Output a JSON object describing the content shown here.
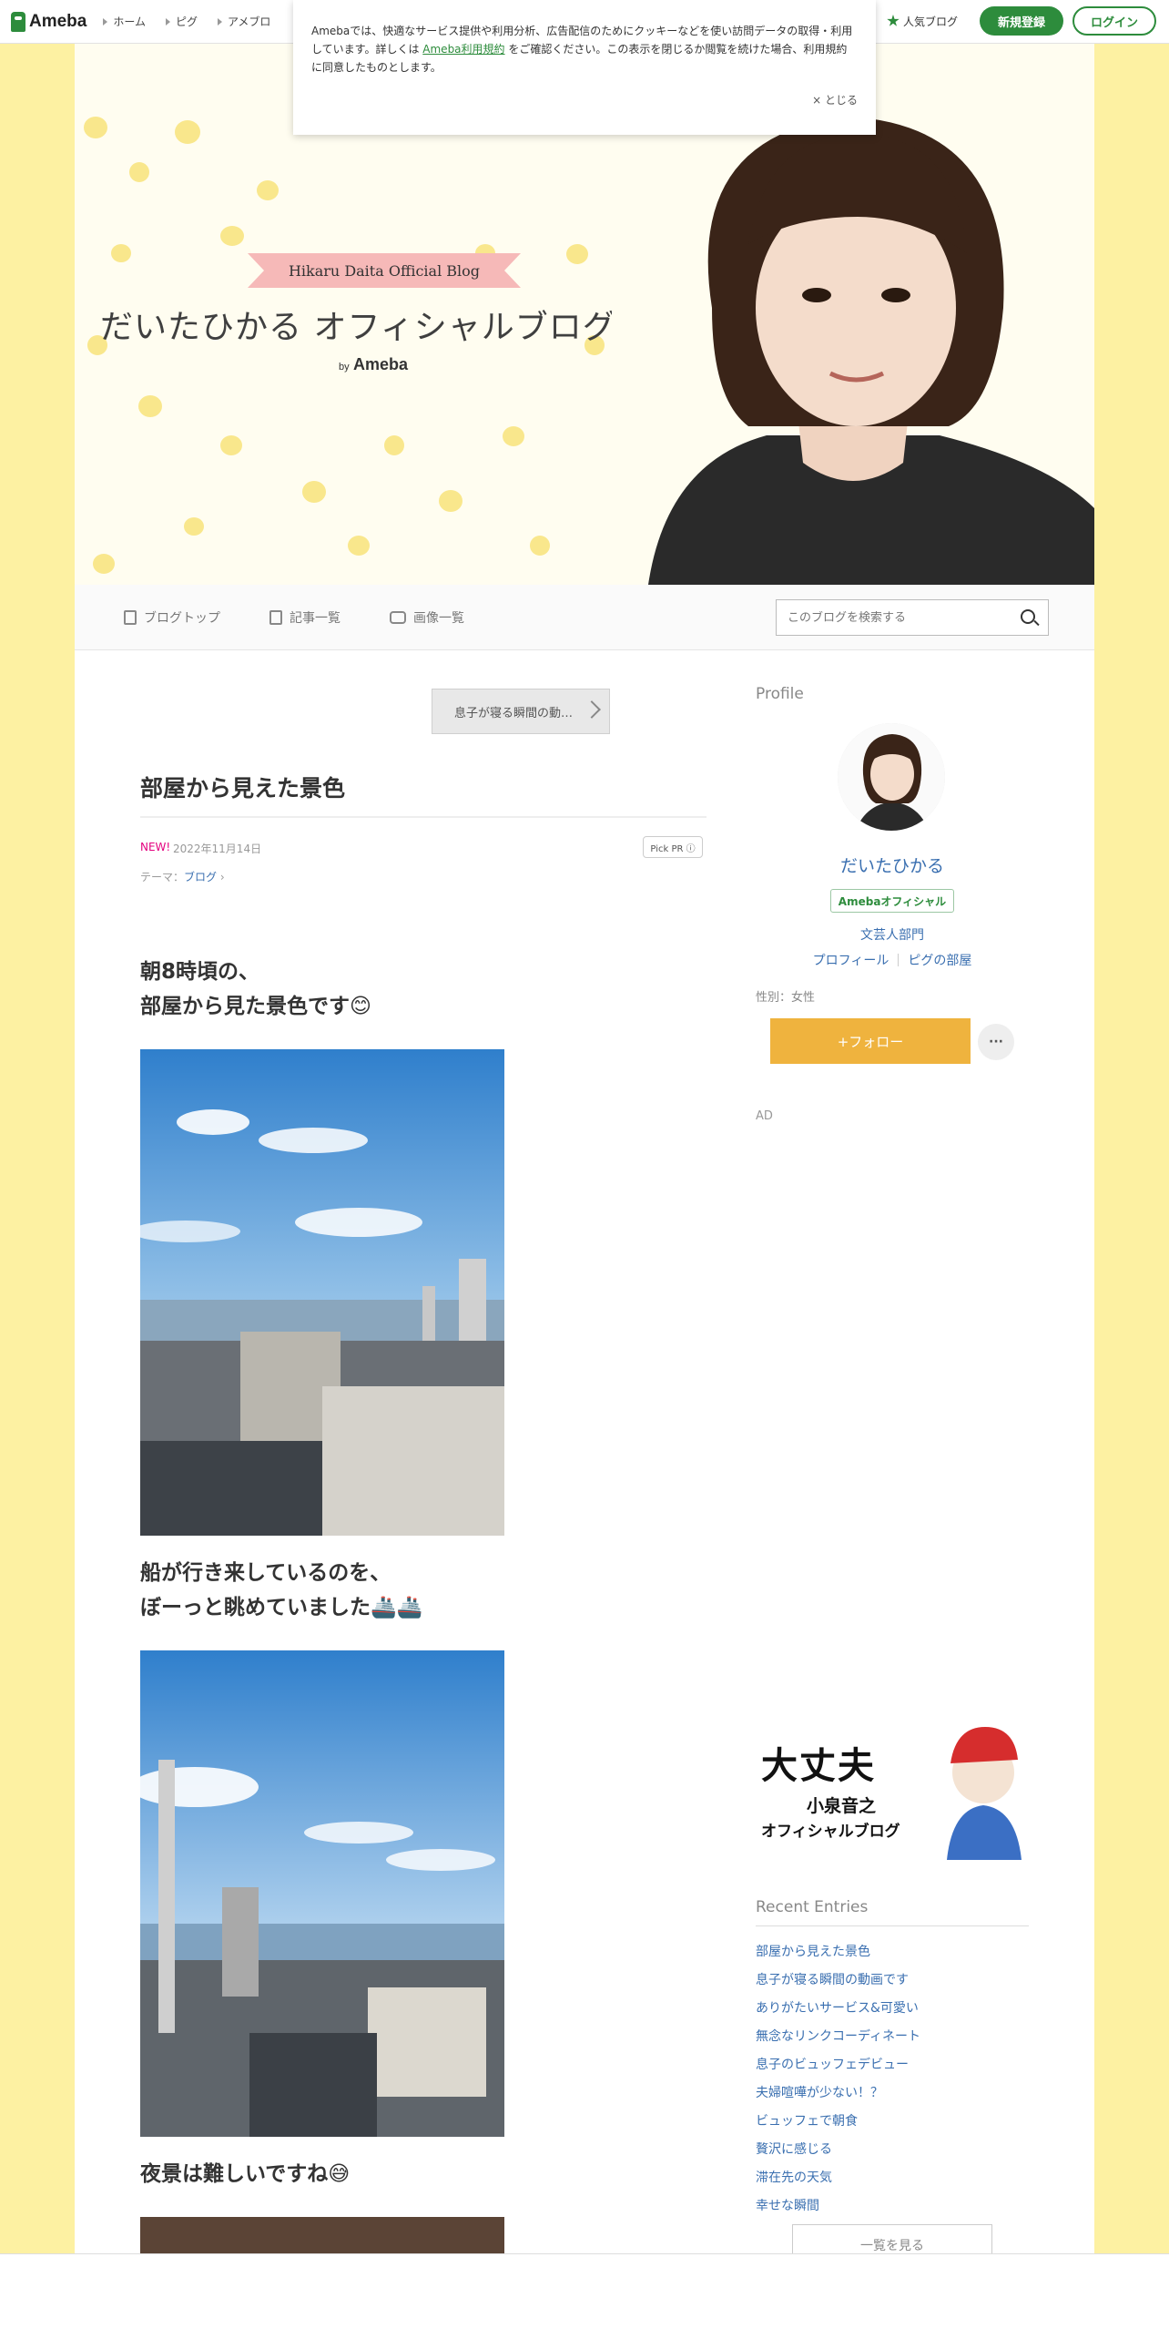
{
  "nav": {
    "logo": "Ameba",
    "links": [
      "ホーム",
      "ピグ",
      "アメブロ"
    ],
    "popular": "人気ブログ",
    "register": "新規登録",
    "login": "ログイン"
  },
  "cookie": {
    "text1": "Amebaでは、快適なサービス提供や利用分析、広告配信のためにクッキーなどを使い訪問データの取得・利用しています。詳しくは",
    "link": "Ameba利用規約",
    "text2": "をご確認ください。この表示を閉じるか閲覧を続けた場合、利用規約に同意したものとします。",
    "close": "× とじる"
  },
  "header": {
    "ribbon": "Hikaru Daita Official Blog",
    "title": "だいたひかる オフィシャルブログ",
    "by": "by",
    "ameba": "Ameba"
  },
  "subnav": {
    "top": "ブログトップ",
    "entries": "記事一覧",
    "images": "画像一覧",
    "search_placeholder": "このブログを検索する"
  },
  "entry": {
    "prev": "息子が寝る瞬間の動…",
    "title": "部屋から見えた景色",
    "new": "NEW!",
    "date": "2022年11月14日",
    "pickpr": "Pick PR ⓘ",
    "theme_label": "テーマ：",
    "theme": "ブログ",
    "p1a": "朝8時頃の、",
    "p1b": "部屋から見た景色です😊",
    "p2a": "船が行き来しているのを、",
    "p2b": "ぼーっと眺めていました🚢🚢",
    "p3": "夜景は難しいですね😅"
  },
  "sidebar": {
    "profile": "Profile",
    "name": "だいたひかる",
    "badge": "Amebaオフィシャル",
    "category": "文芸人部門",
    "profile_link": "プロフィール",
    "pig_link": "ピグの部屋",
    "sex": "性別：女性",
    "follow": "+フォロー",
    "more": "···",
    "ad": "AD",
    "banner_l1": "大丈夫",
    "banner_l2": "小泉音之",
    "banner_l3": "オフィシャルブログ",
    "recent": "Recent Entries",
    "recent_items": [
      "部屋から見えた景色",
      "息子が寝る瞬間の動画です",
      "ありがたいサービス&可愛い",
      "無念なリンクコーディネート",
      "息子のビュッフェデビュー",
      "夫婦喧嘩が少ない！？",
      "ビュッフェで朝食",
      "贅沢に感じる",
      "滞在先の天気",
      "幸せな瞬間"
    ],
    "see_all": "一覧を見る"
  },
  "colors": {
    "brand_green": "#2d8c3c",
    "follow_orange": "#efb33e",
    "link_blue": "#3a6fb0",
    "page_yellow": "#fdf1a2"
  }
}
